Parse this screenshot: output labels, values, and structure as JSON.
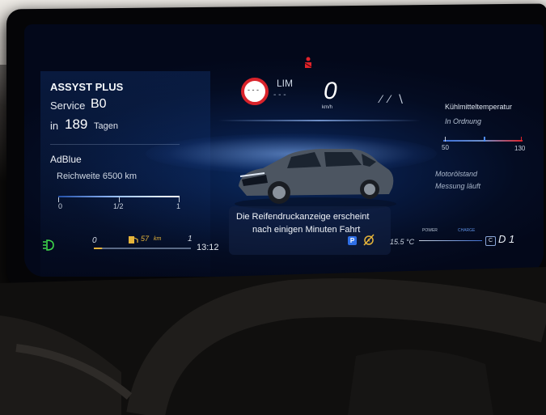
{
  "cluster": {
    "assyst": {
      "title": "ASSYST PLUS",
      "service_label": "Service",
      "service_code": "B0",
      "in_label": "in",
      "days": "189",
      "days_unit": "Tagen"
    },
    "adblue": {
      "title": "AdBlue",
      "range": "Reichweite 6500 km",
      "scale_min": "0",
      "scale_mid": "1/2",
      "scale_max": "1"
    },
    "speed": {
      "value": "0",
      "unit": "km/h",
      "lim_label": "LIM",
      "lim_value": "- - -",
      "cruise": "- - -"
    },
    "traffic_sign": "- - -",
    "lane_indicator": "⁄ ⁄ ∖",
    "coolant": {
      "title": "Kühlmitteltemperatur",
      "status": "In Ordnung",
      "scale_min": "50",
      "scale_max": "130"
    },
    "oil": {
      "title": "Motorölstand",
      "status": "Messung läuft"
    },
    "message": {
      "line1": "Die Reifendruckanzeige erscheint",
      "line2": "nach einigen Minuten Fahrt"
    },
    "fuel": {
      "scale_min": "0",
      "scale_max": "1",
      "range": "57",
      "range_unit": "km"
    },
    "time": "13:12",
    "outside_temp": "15.5 °C",
    "power_label": "POWER",
    "charge_label": "CHARGE",
    "gear_mode": "C",
    "gear": "D 1",
    "parking": "P",
    "colors": {
      "accent_blue": "#2f7dff",
      "warning_red": "#e0232b",
      "lamp_green": "#3ed94a",
      "fuel_amber": "#e6b43a"
    },
    "icons": [
      "seatbelt-warning-icon",
      "no-overtaking-sign-icon",
      "headlight-icon",
      "fuel-pump-icon",
      "parking-icon",
      "auto-start-stop-off-icon"
    ]
  }
}
